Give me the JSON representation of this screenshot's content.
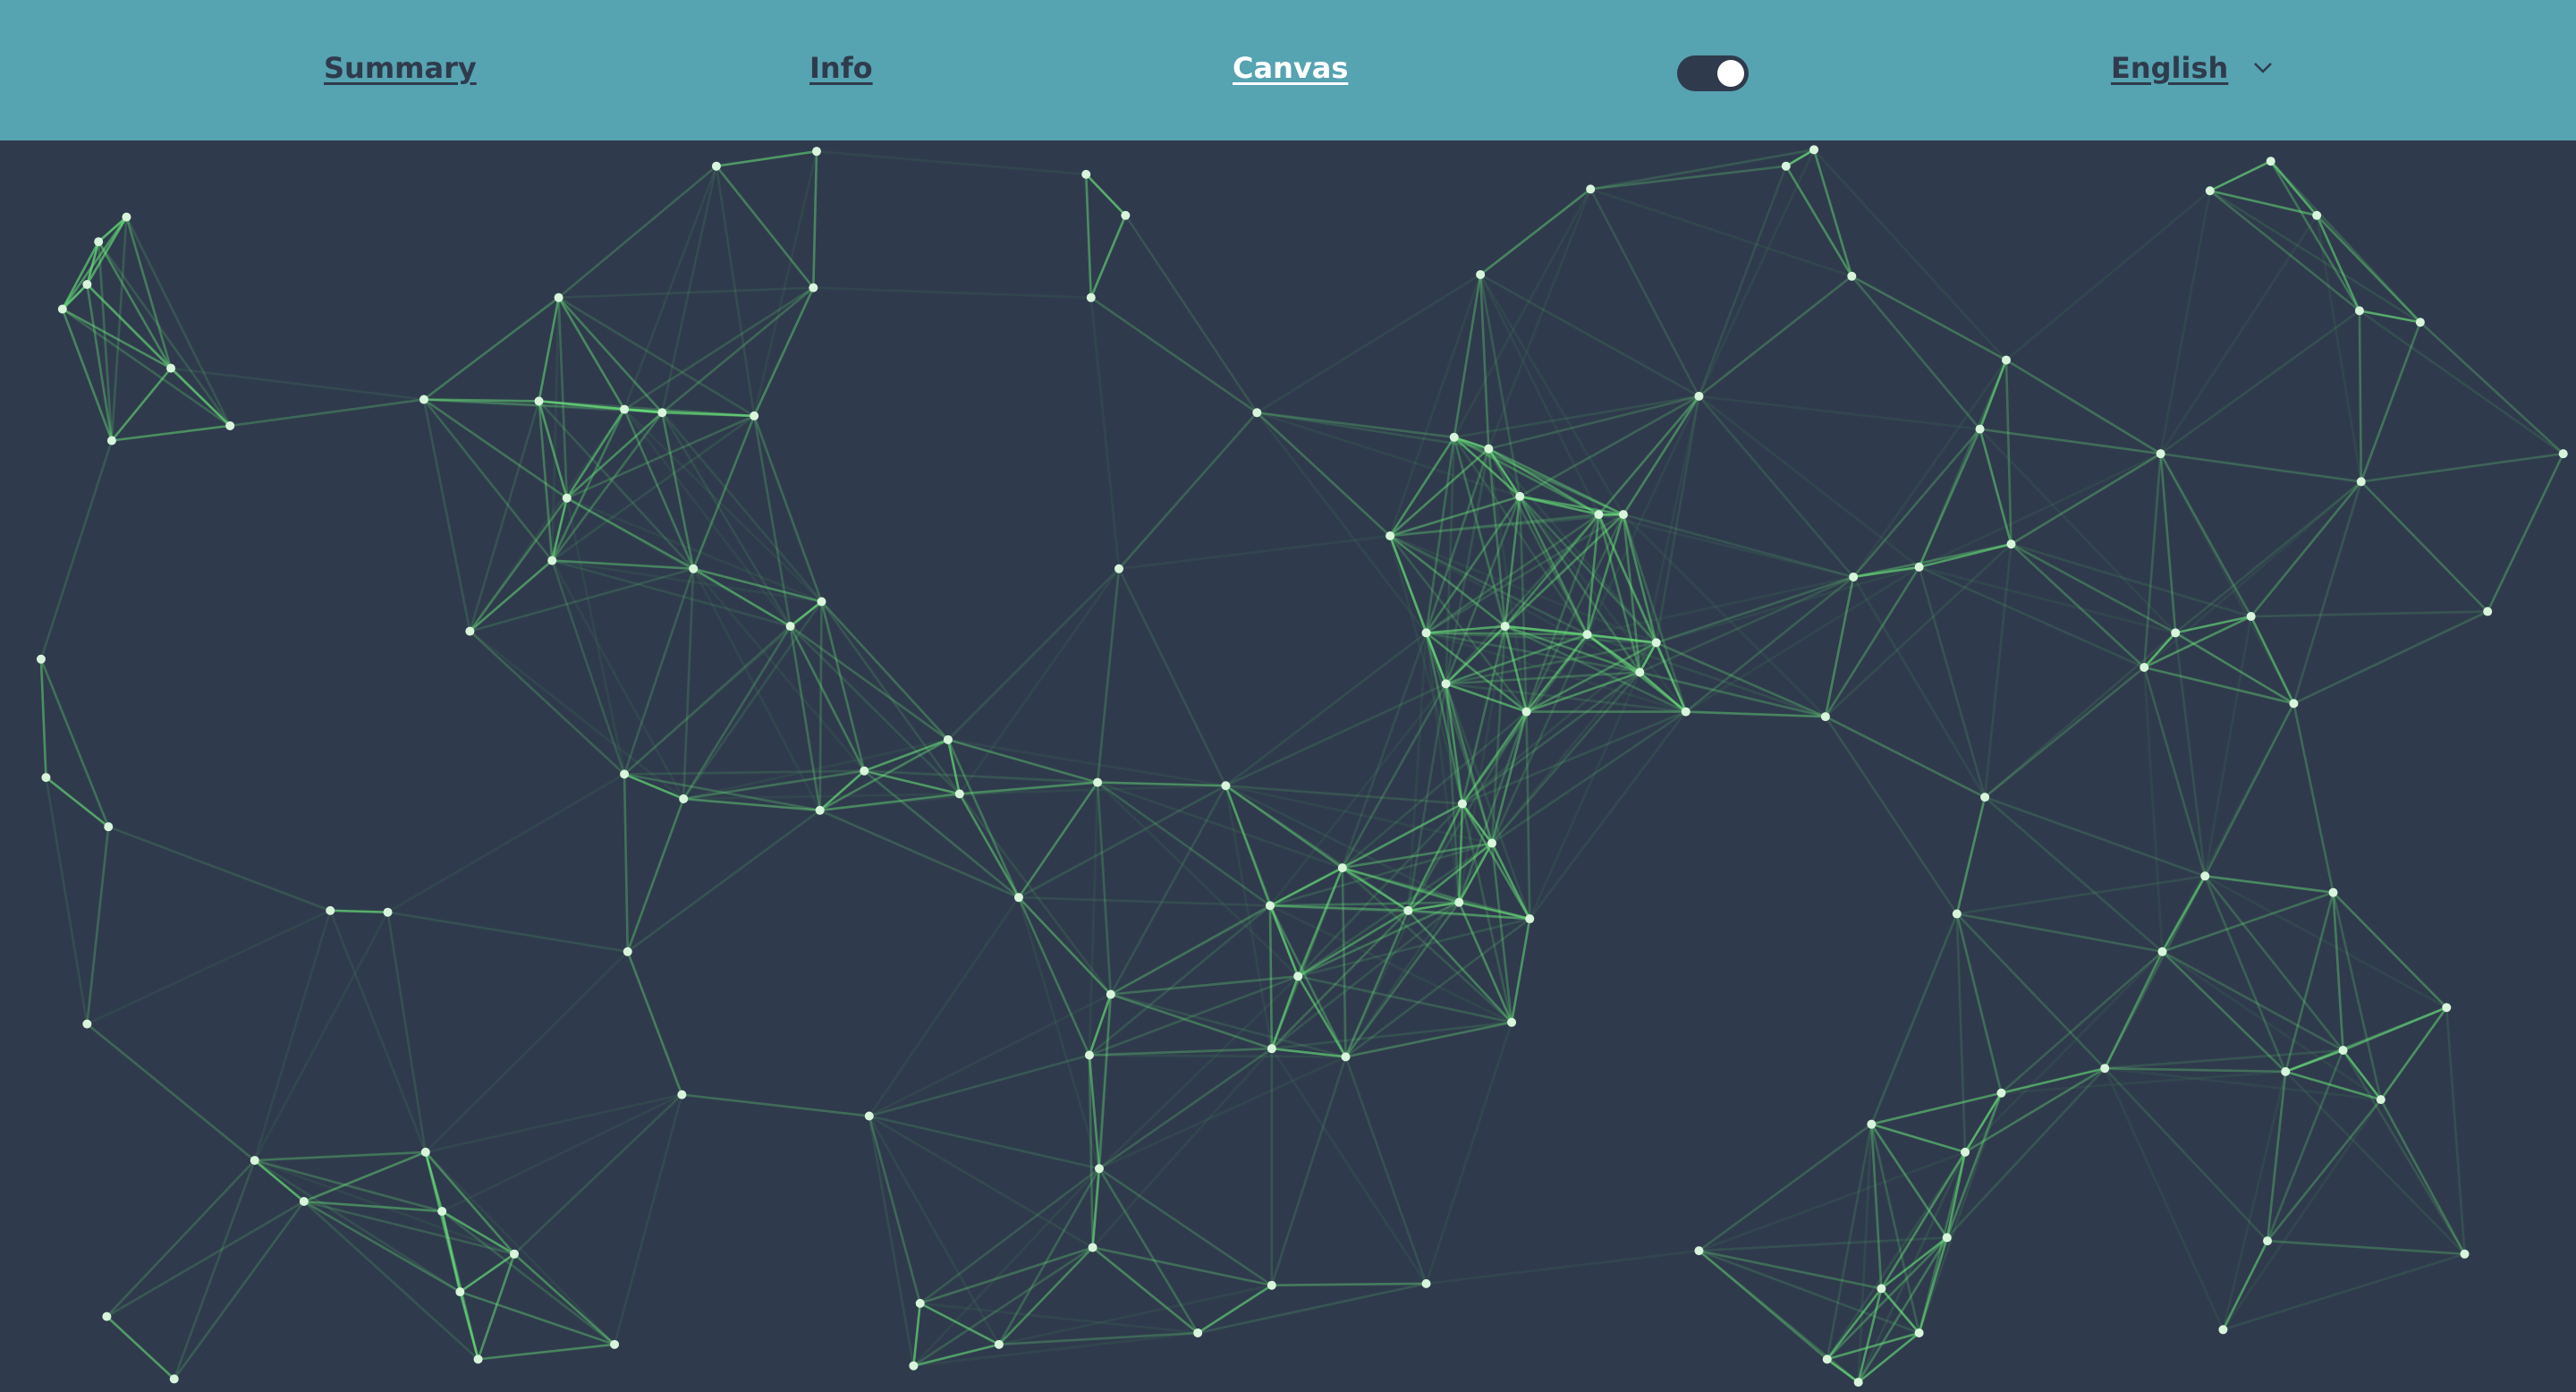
{
  "nav": {
    "summary": "Summary",
    "info": "Info",
    "canvas": "Canvas",
    "active": "canvas"
  },
  "theme_toggle": {
    "on": true
  },
  "language": {
    "selected": "English"
  },
  "colors": {
    "header_bg": "#56a3b1",
    "canvas_bg": "#2f3b4c",
    "link_dark": "#2f3b4c",
    "link_active": "#ffffff",
    "edge": "#69e37a",
    "node": "#d8f5dc"
  }
}
